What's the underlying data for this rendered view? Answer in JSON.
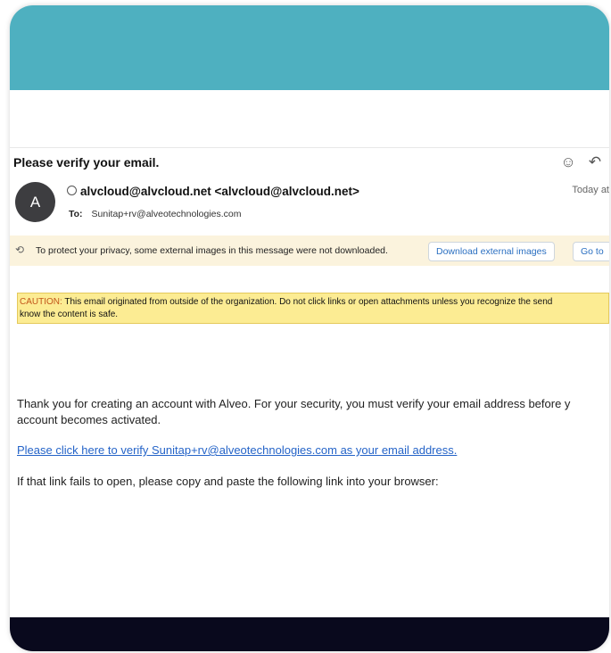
{
  "email": {
    "subject": "Please verify your email.",
    "header_icons": [
      "emoji-reaction-icon",
      "reply-icon"
    ],
    "avatar_initial": "A",
    "sender": "alvcloud@alvcloud.net <alvcloud@alvcloud.net>",
    "time": "Today at",
    "to_label": "To:",
    "to_address": "Sunitap+rv@alveotechnologies.com"
  },
  "privacy_bar": {
    "text": "To protect your privacy, some external images in this message were not downloaded.",
    "download_button": "Download external images",
    "goto_button": "Go to"
  },
  "caution": {
    "label": "CAUTION:",
    "line1": " This email originated from outside of the organization. Do not click links or open attachments unless you recognize the send",
    "line2": "know the content is safe."
  },
  "body": {
    "paragraph1_line1": "Thank you for creating an account with Alveo. For your security, you must verify your email address before y",
    "paragraph1_line2": "account becomes activated.",
    "verify_link": "Please click here to verify Sunitap+rv@alveotechnologies.com as your email address.",
    "paragraph2": "If that link fails to open, please copy and paste the following link into your browser:"
  },
  "colors": {
    "top_band": "#4eb0c0",
    "bottom_band": "#09091d",
    "caution_bg": "#fcec93",
    "link": "#2564c8"
  }
}
